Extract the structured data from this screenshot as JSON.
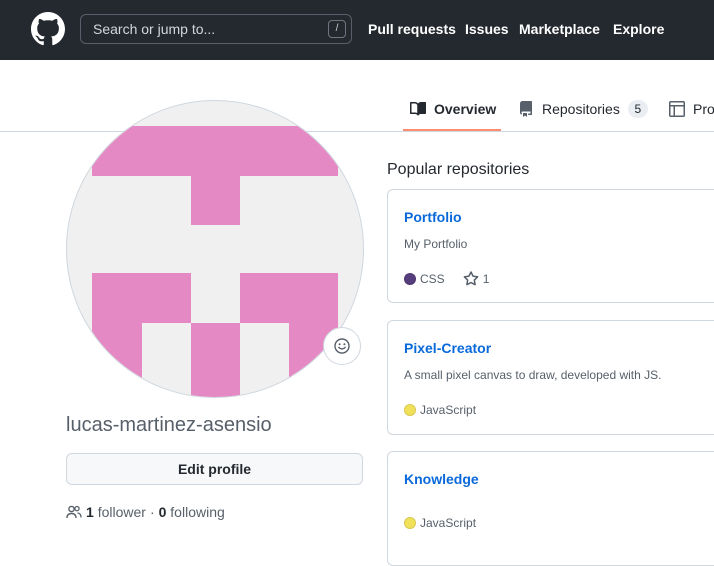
{
  "header": {
    "search_placeholder": "Search or jump to...",
    "search_shortcut": "/",
    "nav": [
      "Pull requests",
      "Issues",
      "Marketplace",
      "Explore"
    ]
  },
  "tabs": {
    "overview": "Overview",
    "repositories": "Repositories",
    "repositories_count": "5",
    "projects": "Pro"
  },
  "profile": {
    "username": "lucas-martinez-asensio",
    "edit_button": "Edit profile",
    "followers_count": "1",
    "followers_label": "follower",
    "separator": "·",
    "following_count": "0",
    "following_label": "following"
  },
  "popular": {
    "title": "Popular repositories",
    "repos": [
      {
        "name": "Portfolio",
        "description": "My Portfolio",
        "language": "CSS",
        "lang_color": "#563d7c",
        "stars": "1"
      },
      {
        "name": "Pixel-Creator",
        "description": "A small pixel canvas to draw, developed with JS.",
        "language": "JavaScript",
        "lang_color": "#f1e05a"
      },
      {
        "name": "Knowledge",
        "description": "",
        "language": "JavaScript",
        "lang_color": "#f1e05a"
      }
    ]
  },
  "colors": {
    "header_bg": "#24292f",
    "accent_link": "#0969da",
    "tab_underline": "#fd8c73",
    "avatar_pink": "#e489c3"
  }
}
